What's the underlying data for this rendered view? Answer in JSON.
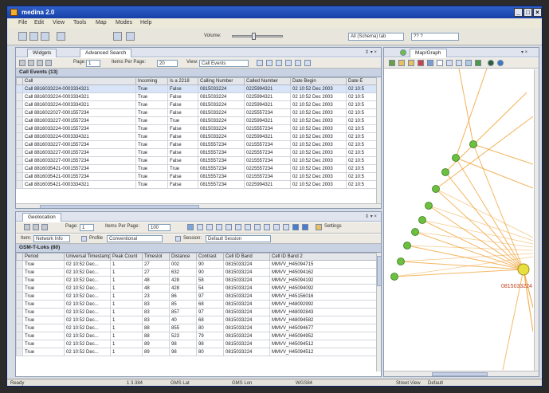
{
  "window": {
    "title": "medina 2.0"
  },
  "menu": [
    "File",
    "Edit",
    "View",
    "Tools",
    "Map",
    "Modes",
    "Help"
  ],
  "toolbar": {
    "volume_label": "Volume:",
    "dropdown1": "All (Schema) tab",
    "search_value": "?? ?"
  },
  "left_top": {
    "tabs": [
      "Widgets",
      "Advanced Search"
    ],
    "pager": {
      "page_label": "Page:",
      "page_value": "1",
      "items_label": "Items Per Page:",
      "items_value": "20",
      "view_label": "View:",
      "view_value": "Call Events"
    },
    "caption": "Call Events (13)",
    "columns": [
      "",
      "Call",
      "Incoming",
      "Is a 2218",
      "Calling Number",
      "Called Number",
      "Date Begin",
      "Date E"
    ],
    "rows": [
      [
        "Call 8816033224-0003334321",
        "True",
        "False",
        "0815033224",
        "0225994321",
        "02 10:52 Dec 2003",
        "02 10:5"
      ],
      [
        "Call 8816033224-0003334321",
        "True",
        "False",
        "0815033224",
        "0225994321",
        "02 10:52 Dec 2003",
        "02 10:5"
      ],
      [
        "Call 8816033224-0003334321",
        "True",
        "False",
        "0815033224",
        "0225994321",
        "02 10:52 Dec 2003",
        "02 10:5"
      ],
      [
        "Call 8816022027-0001557234",
        "True",
        "False",
        "0815033224",
        "0225557234",
        "02 10:52 Dec 2003",
        "02 10:5"
      ],
      [
        "Call 8816033227-0001557234",
        "True",
        "True",
        "0815033224",
        "0225994321",
        "02 10:52 Dec 2003",
        "02 10:5"
      ],
      [
        "Call 8816033224-0001557234",
        "True",
        "False",
        "0815033224",
        "0215557234",
        "02 10:52 Dec 2003",
        "02 10:5"
      ],
      [
        "Call 8816033224-0003334321",
        "True",
        "False",
        "0815033224",
        "0225994321",
        "02 10:52 Dec 2003",
        "02 10:5"
      ],
      [
        "Call 8816033227-0001557234",
        "True",
        "False",
        "0815557234",
        "0215557234",
        "02 10:52 Dec 2003",
        "02 10:5"
      ],
      [
        "Call 8816033227-0001557234",
        "True",
        "False",
        "0815557234",
        "0225557234",
        "02 10:52 Dec 2003",
        "02 10:5"
      ],
      [
        "Call 8816033227-0001557234",
        "True",
        "False",
        "0815557234",
        "0215557234",
        "02 10:52 Dec 2003",
        "02 10:5"
      ],
      [
        "Call 8816035421-0001557234",
        "True",
        "True",
        "0815557234",
        "0225557234",
        "02 10:52 Dec 2003",
        "02 10:5"
      ],
      [
        "Call 8816035421-0001557234",
        "True",
        "False",
        "0815557234",
        "0215557234",
        "02 10:52 Dec 2003",
        "02 10:5"
      ],
      [
        "Call 8816035421-0003334321",
        "True",
        "False",
        "0815557234",
        "0225994321",
        "02 10:52 Dec 2003",
        "02 10:5"
      ]
    ]
  },
  "left_bottom": {
    "tab": "Geolocation",
    "pager": {
      "page_label": "Page:",
      "page_value": "1",
      "items_label": "Items Per Page:",
      "items_value": "100",
      "settings_label": "Settings"
    },
    "filter": {
      "item_label": "Item:",
      "item_value": "Network Info",
      "profile_label": "Profile",
      "profile_value": "Conventional",
      "session_label": "Session:",
      "session_value": "Default Session"
    },
    "caption": "GSM-T-Loks (80)",
    "columns": [
      "",
      "Period",
      "Universal Timestamp",
      "Peak Count",
      "Timeslot",
      "Distance",
      "Contrast",
      "Cell ID Band",
      "Cell ID Band 2"
    ],
    "rows": [
      [
        "True",
        "02 10:52 Dec...",
        "1",
        "27",
        "002",
        "90",
        "0815033224",
        "MMVV_H45094715"
      ],
      [
        "True",
        "02 10:52 Dec...",
        "1",
        "27",
        "632",
        "90",
        "0815033224",
        "MMVV_H45094162"
      ],
      [
        "True",
        "02 10:52 Dec...",
        "1",
        "48",
        "428",
        "58",
        "0815033224",
        "MMVV_H45094192"
      ],
      [
        "True",
        "02 10:52 Dec...",
        "1",
        "48",
        "428",
        "54",
        "0815033224",
        "MMVV_H45094092"
      ],
      [
        "True",
        "02 10:52 Dec...",
        "1",
        "23",
        "86",
        "97",
        "0815033224",
        "MMVV_H45156016"
      ],
      [
        "True",
        "02 10:52 Dec...",
        "1",
        "83",
        "85",
        "68",
        "0815033224",
        "MMVV_H48092992"
      ],
      [
        "True",
        "02 10:52 Dec...",
        "1",
        "83",
        "857",
        "97",
        "0815033224",
        "MMVV_H48092843"
      ],
      [
        "True",
        "02 10:52 Dec...",
        "1",
        "83",
        "40",
        "68",
        "0815033224",
        "MMVV_H48094582"
      ],
      [
        "True",
        "02 10:52 Dec...",
        "1",
        "88",
        "855",
        "80",
        "0815033224",
        "MMVV_H45094677"
      ],
      [
        "True",
        "02 10:52 Dec...",
        "1",
        "88",
        "523",
        "79",
        "0815033224",
        "MMVV_H45094952"
      ],
      [
        "True",
        "02 10:52 Dec...",
        "1",
        "89",
        "98",
        "98",
        "0815033224",
        "MMVV_H45094512"
      ],
      [
        "True",
        "02 10:52 Dec...",
        "1",
        "89",
        "98",
        "80",
        "0815033224",
        "MMVV_H45094512"
      ]
    ]
  },
  "right": {
    "tab": "Map/Graph",
    "node_label": "0815033224"
  },
  "status": {
    "ready": "Ready",
    "coord": "1 3.384",
    "gms_lat": "GMS Lat",
    "gms_lon": "GMS Lon",
    "mode": "WGS84",
    "street_view": "Street View",
    "default": "Default"
  },
  "colors": {
    "edge": "#f0a030",
    "node": "#6cc040",
    "selected_node": "#e8e040",
    "title_bar": "#1f4bb6"
  }
}
